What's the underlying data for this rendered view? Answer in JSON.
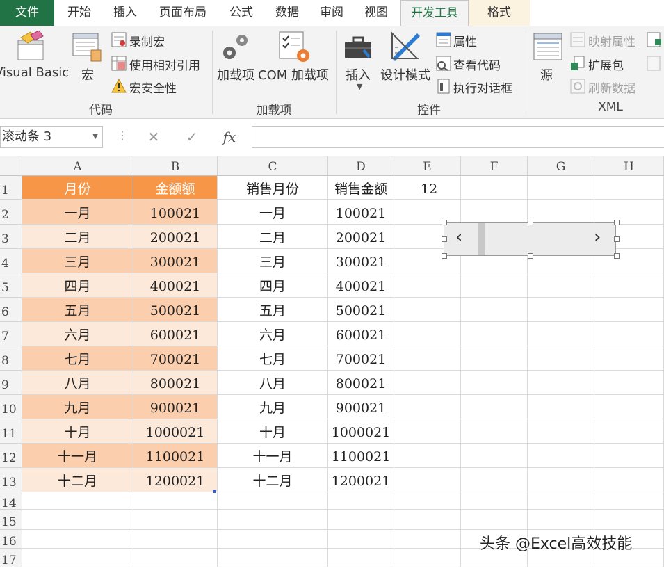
{
  "tabs": [
    {
      "label": "文件",
      "kind": "file"
    },
    {
      "label": "开始",
      "kind": "normal"
    },
    {
      "label": "插入",
      "kind": "normal"
    },
    {
      "label": "页面布局",
      "kind": "normal"
    },
    {
      "label": "公式",
      "kind": "normal"
    },
    {
      "label": "数据",
      "kind": "normal"
    },
    {
      "label": "审阅",
      "kind": "normal"
    },
    {
      "label": "视图",
      "kind": "normal"
    },
    {
      "label": "开发工具",
      "kind": "active"
    },
    {
      "label": "格式",
      "kind": "context"
    }
  ],
  "ribbon": {
    "code": {
      "label": "代码",
      "visual_basic": "Visual Basic",
      "macros": "宏",
      "record_macro": "录制宏",
      "relative_ref": "使用相对引用",
      "macro_security": "宏安全性"
    },
    "addins": {
      "label": "加载项",
      "addins": "加载项",
      "com_addins": "COM 加载项"
    },
    "controls": {
      "label": "控件",
      "insert": "插入",
      "design_mode": "设计模式",
      "properties": "属性",
      "view_code": "查看代码",
      "run_dialog": "执行对话框"
    },
    "xml": {
      "label": "XML",
      "source": "源",
      "map_properties": "映射属性",
      "expansion_packs": "扩展包",
      "refresh_data": "刷新数据"
    }
  },
  "formula_bar": {
    "name_box": "滚动条 3",
    "cancel": "✕",
    "enter": "✓",
    "fx": "fx",
    "formula": ""
  },
  "columns": [
    "A",
    "B",
    "C",
    "D",
    "E",
    "F",
    "G",
    "H"
  ],
  "rows": [
    "1",
    "2",
    "3",
    "4",
    "5",
    "6",
    "7",
    "8",
    "9",
    "10",
    "11",
    "12",
    "13",
    "14",
    "15",
    "16",
    "17"
  ],
  "table": {
    "headers": [
      "月份",
      "金额额",
      "销售月份",
      "销售金额"
    ],
    "data": [
      [
        "一月",
        "100021",
        "一月",
        "100021"
      ],
      [
        "二月",
        "200021",
        "二月",
        "200021"
      ],
      [
        "三月",
        "300021",
        "三月",
        "300021"
      ],
      [
        "四月",
        "400021",
        "四月",
        "400021"
      ],
      [
        "五月",
        "500021",
        "五月",
        "500021"
      ],
      [
        "六月",
        "600021",
        "六月",
        "600021"
      ],
      [
        "七月",
        "700021",
        "七月",
        "700021"
      ],
      [
        "八月",
        "800021",
        "八月",
        "800021"
      ],
      [
        "九月",
        "900021",
        "九月",
        "900021"
      ],
      [
        "十月",
        "1000021",
        "十月",
        "1000021"
      ],
      [
        "十一月",
        "1100021",
        "十一月",
        "1100021"
      ],
      [
        "十二月",
        "1200021",
        "十二月",
        "1200021"
      ]
    ]
  },
  "cell_E1": "12",
  "scrollbar": {
    "left_arrow": "‹",
    "right_arrow": "›"
  },
  "watermark": "头条 @Excel高效技能",
  "colors": {
    "file_tab": "#217346",
    "header_orange": "#f79646",
    "band_dark": "#fbcfae",
    "band_light": "#fde9da"
  }
}
